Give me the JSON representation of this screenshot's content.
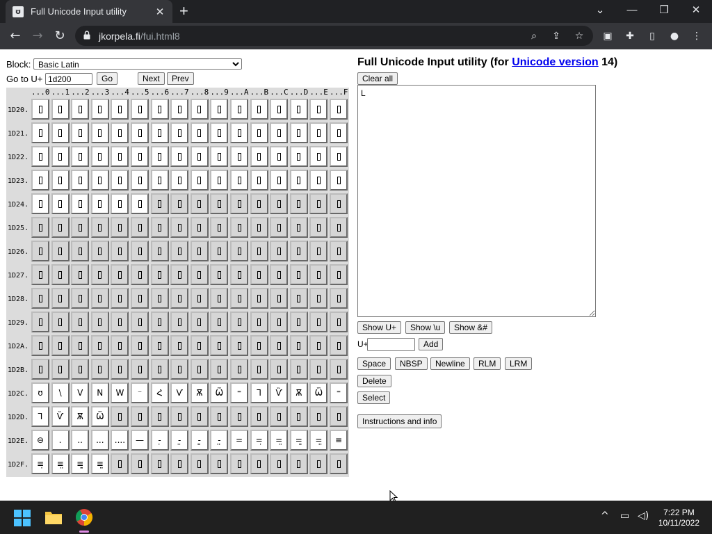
{
  "browser": {
    "tab_title": "Full Unicode Input utility",
    "tab_favicon": "ʊ",
    "new_tab": "+",
    "url_host": "jkorpela.fi",
    "url_path": "/fui.html8"
  },
  "page": {
    "block_label": "Block:",
    "block_selected": "Basic Latin",
    "goto_label": "Go to U+",
    "goto_value": "1d200",
    "go_button": "Go",
    "next_button": "Next",
    "prev_button": "Prev",
    "title_prefix": "Full Unicode Input utility (for ",
    "title_link": "Unicode version",
    "title_suffix": " 14)",
    "clear_button": "Clear all",
    "output_text": "L",
    "show_u_button": "Show U+",
    "show_backslash_button": "Show \\u",
    "show_entity_button": "Show &#",
    "add_label": "U+",
    "add_button": "Add",
    "space_button": "Space",
    "nbsp_button": "NBSP",
    "newline_button": "Newline",
    "rlm_button": "RLM",
    "lrm_button": "LRM",
    "delete_button": "Delete",
    "select_button": "Select",
    "instructions_button": "Instructions and info"
  },
  "grid": {
    "col_headers": [
      "...0",
      "...1",
      "...2",
      "...3",
      "...4",
      "...5",
      "...6",
      "...7",
      "...8",
      "...9",
      "...A",
      "...B",
      "...C",
      "...D",
      "...E",
      "...F"
    ],
    "row_headers": [
      "1D20.",
      "1D21.",
      "1D22.",
      "1D23.",
      "1D24.",
      "1D25.",
      "1D26.",
      "1D27.",
      "1D28.",
      "1D29.",
      "1D2A.",
      "1D2B.",
      "1D2C.",
      "1D2D.",
      "1D2E.",
      "1D2F."
    ],
    "rows": [
      [
        "□",
        "□",
        "□",
        "□",
        "□",
        "□",
        "□",
        "□",
        "□",
        "□",
        "□",
        "□",
        "□",
        "□",
        "□",
        "□"
      ],
      [
        "□",
        "□",
        "□",
        "□",
        "□",
        "□",
        "□",
        "□",
        "□",
        "□",
        "□",
        "□",
        "□",
        "□",
        "□",
        "□"
      ],
      [
        "□",
        "□",
        "□",
        "□",
        "□",
        "□",
        "□",
        "□",
        "□",
        "□",
        "□",
        "□",
        "□",
        "□",
        "□",
        "□"
      ],
      [
        "□",
        "□",
        "□",
        "□",
        "□",
        "□",
        "□",
        "□",
        "□",
        "□",
        "□",
        "□",
        "□",
        "□",
        "□",
        "□"
      ],
      [
        "□",
        "□",
        "□",
        "□",
        "□",
        "□",
        "▪",
        "▪",
        "▪",
        "▪",
        "▪",
        "▪",
        "▪",
        "▪",
        "▪",
        "▪"
      ],
      [
        "▪",
        "▪",
        "▪",
        "▪",
        "▪",
        "▪",
        "▪",
        "▪",
        "▪",
        "▪",
        "▪",
        "▪",
        "▪",
        "▪",
        "▪",
        "▪"
      ],
      [
        "▪",
        "▪",
        "▪",
        "▪",
        "▪",
        "▪",
        "▪",
        "▪",
        "▪",
        "▪",
        "▪",
        "▪",
        "▪",
        "▪",
        "▪",
        "▪"
      ],
      [
        "▪",
        "▪",
        "▪",
        "▪",
        "▪",
        "▪",
        "▪",
        "▪",
        "▪",
        "▪",
        "▪",
        "▪",
        "▪",
        "▪",
        "▪",
        "▪"
      ],
      [
        "▪",
        "▪",
        "▪",
        "▪",
        "▪",
        "▪",
        "▪",
        "▪",
        "▪",
        "▪",
        "▪",
        "▪",
        "▪",
        "▪",
        "▪",
        "▪"
      ],
      [
        "▪",
        "▪",
        "▪",
        "▪",
        "▪",
        "▪",
        "▪",
        "▪",
        "▪",
        "▪",
        "▪",
        "▪",
        "▪",
        "▪",
        "▪",
        "▪"
      ],
      [
        "▪",
        "▪",
        "▪",
        "▪",
        "▪",
        "▪",
        "▪",
        "▪",
        "▪",
        "▪",
        "▪",
        "▪",
        "▪",
        "▪",
        "▪",
        "▪"
      ],
      [
        "▪",
        "▪",
        "▪",
        "▪",
        "▪",
        "▪",
        "▪",
        "▪",
        "▪",
        "▪",
        "▪",
        "▪",
        "▪",
        "▪",
        "▪",
        "▪"
      ],
      [
        "ʊ",
        "\\",
        "V",
        "N",
        "W",
        "⁻",
        "Հ",
        "Ѵ",
        "Ѫ",
        "Ѿ",
        "⁼",
        "Ꞁ",
        "Ѷ",
        "Ѫ",
        "Ѿ",
        "⁼"
      ],
      [
        "Ꞁ",
        "Ѷ",
        "Ѫ",
        "Ѿ",
        "▪",
        "▪",
        "▪",
        "▪",
        "▪",
        "▪",
        "▪",
        "▪",
        "▪",
        "▪",
        "▪",
        "▪"
      ],
      [
        "⊖",
        ".",
        "..",
        "...",
        "....",
        "—",
        "-̣",
        "-̤",
        "-̤̣",
        "-̤̤",
        "=",
        "=̣",
        "=̤",
        "=̤̣",
        "=̤̤",
        "≡"
      ],
      [
        "≡̣",
        "≡̤",
        "≡̤̣",
        "≡̤̤",
        "▪",
        "▪",
        "▪",
        "▪",
        "▪",
        "▪",
        "▪",
        "▪",
        "▪",
        "▪",
        "▪",
        "▪"
      ]
    ]
  },
  "taskbar": {
    "time": "7:22 PM",
    "date": "10/11/2022"
  }
}
